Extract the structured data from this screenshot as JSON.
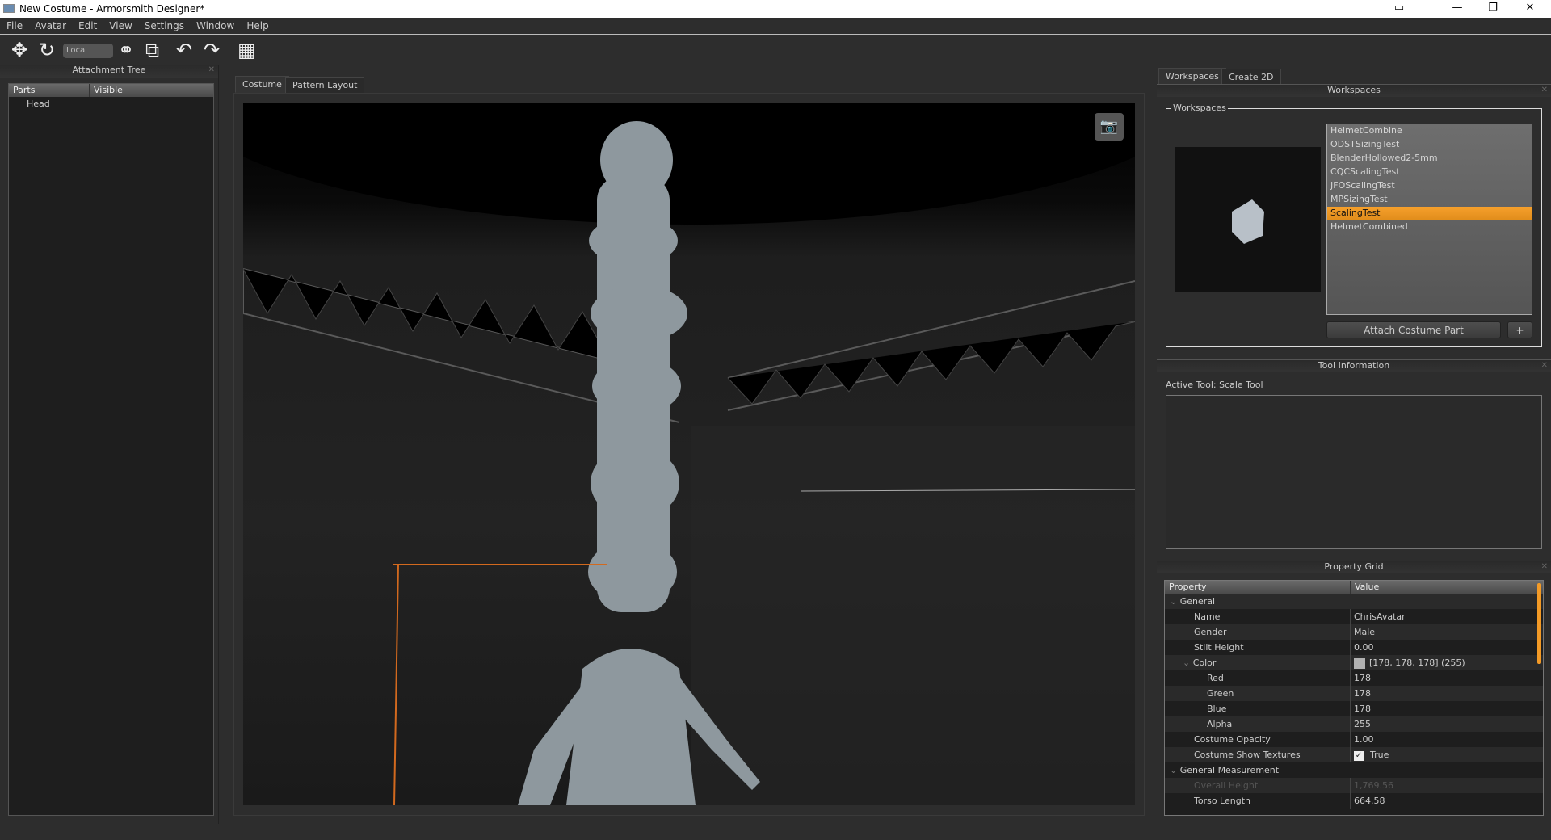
{
  "window": {
    "title": "New Costume - Armorsmith Designer*",
    "controls": [
      "▭",
      "—",
      "❐",
      "✕"
    ]
  },
  "menu": [
    "File",
    "Avatar",
    "Edit",
    "View",
    "Settings",
    "Window",
    "Help"
  ],
  "toolbar": {
    "coord_space": "Local",
    "icons": [
      "move-icon",
      "rotate-icon",
      "link-icon",
      "external-icon",
      "undo-icon",
      "redo-icon",
      "grid-icon"
    ]
  },
  "attachment_tree": {
    "title": "Attachment Tree",
    "columns": [
      "Parts",
      "Visible"
    ],
    "items": [
      "Head"
    ]
  },
  "center": {
    "tabs": [
      "Costume",
      "Pattern Layout"
    ],
    "active_tab": "Costume"
  },
  "right": {
    "tabs": [
      "Workspaces",
      "Create 2D"
    ],
    "workspaces": {
      "title": "Workspaces",
      "group_label": "Workspaces",
      "items": [
        "HelmetCombine",
        "ODSTSizingTest",
        "BlenderHollowed2-5mm",
        "CQCScalingTest",
        "JFOScalingTest",
        "MPSizingTest",
        "ScalingTest",
        "HelmetCombined"
      ],
      "selected": "ScalingTest",
      "attach_label": "Attach Costume Part",
      "add_label": "+"
    },
    "tool_info": {
      "title": "Tool Information",
      "active_tool": "Active Tool: Scale Tool"
    },
    "property_grid": {
      "title": "Property Grid",
      "columns": [
        "Property",
        "Value"
      ],
      "rows": [
        {
          "k": "General",
          "v": "",
          "level": 0,
          "group": true
        },
        {
          "k": "Name",
          "v": "ChrisAvatar",
          "level": 1
        },
        {
          "k": "Gender",
          "v": "Male",
          "level": 1
        },
        {
          "k": "Stilt Height",
          "v": "0.00",
          "level": 1
        },
        {
          "k": "Color",
          "v": "[178, 178, 178] (255)",
          "level": 1,
          "group": true,
          "swatch": "#b2b2b2"
        },
        {
          "k": "Red",
          "v": "178",
          "level": 2
        },
        {
          "k": "Green",
          "v": "178",
          "level": 2
        },
        {
          "k": "Blue",
          "v": "178",
          "level": 2
        },
        {
          "k": "Alpha",
          "v": "255",
          "level": 2
        },
        {
          "k": "Costume Opacity",
          "v": "1.00",
          "level": 1
        },
        {
          "k": "Costume Show Textures",
          "v": "True",
          "level": 1,
          "checkbox": true
        },
        {
          "k": "General Measurement",
          "v": "",
          "level": 0,
          "group": true
        },
        {
          "k": "Overall Height",
          "v": "1,769.56",
          "level": 1,
          "disabled": true
        },
        {
          "k": "Torso Length",
          "v": "664.58",
          "level": 1
        }
      ]
    }
  },
  "colors": {
    "accent": "#f39a26",
    "background": "#2d2d2d"
  }
}
